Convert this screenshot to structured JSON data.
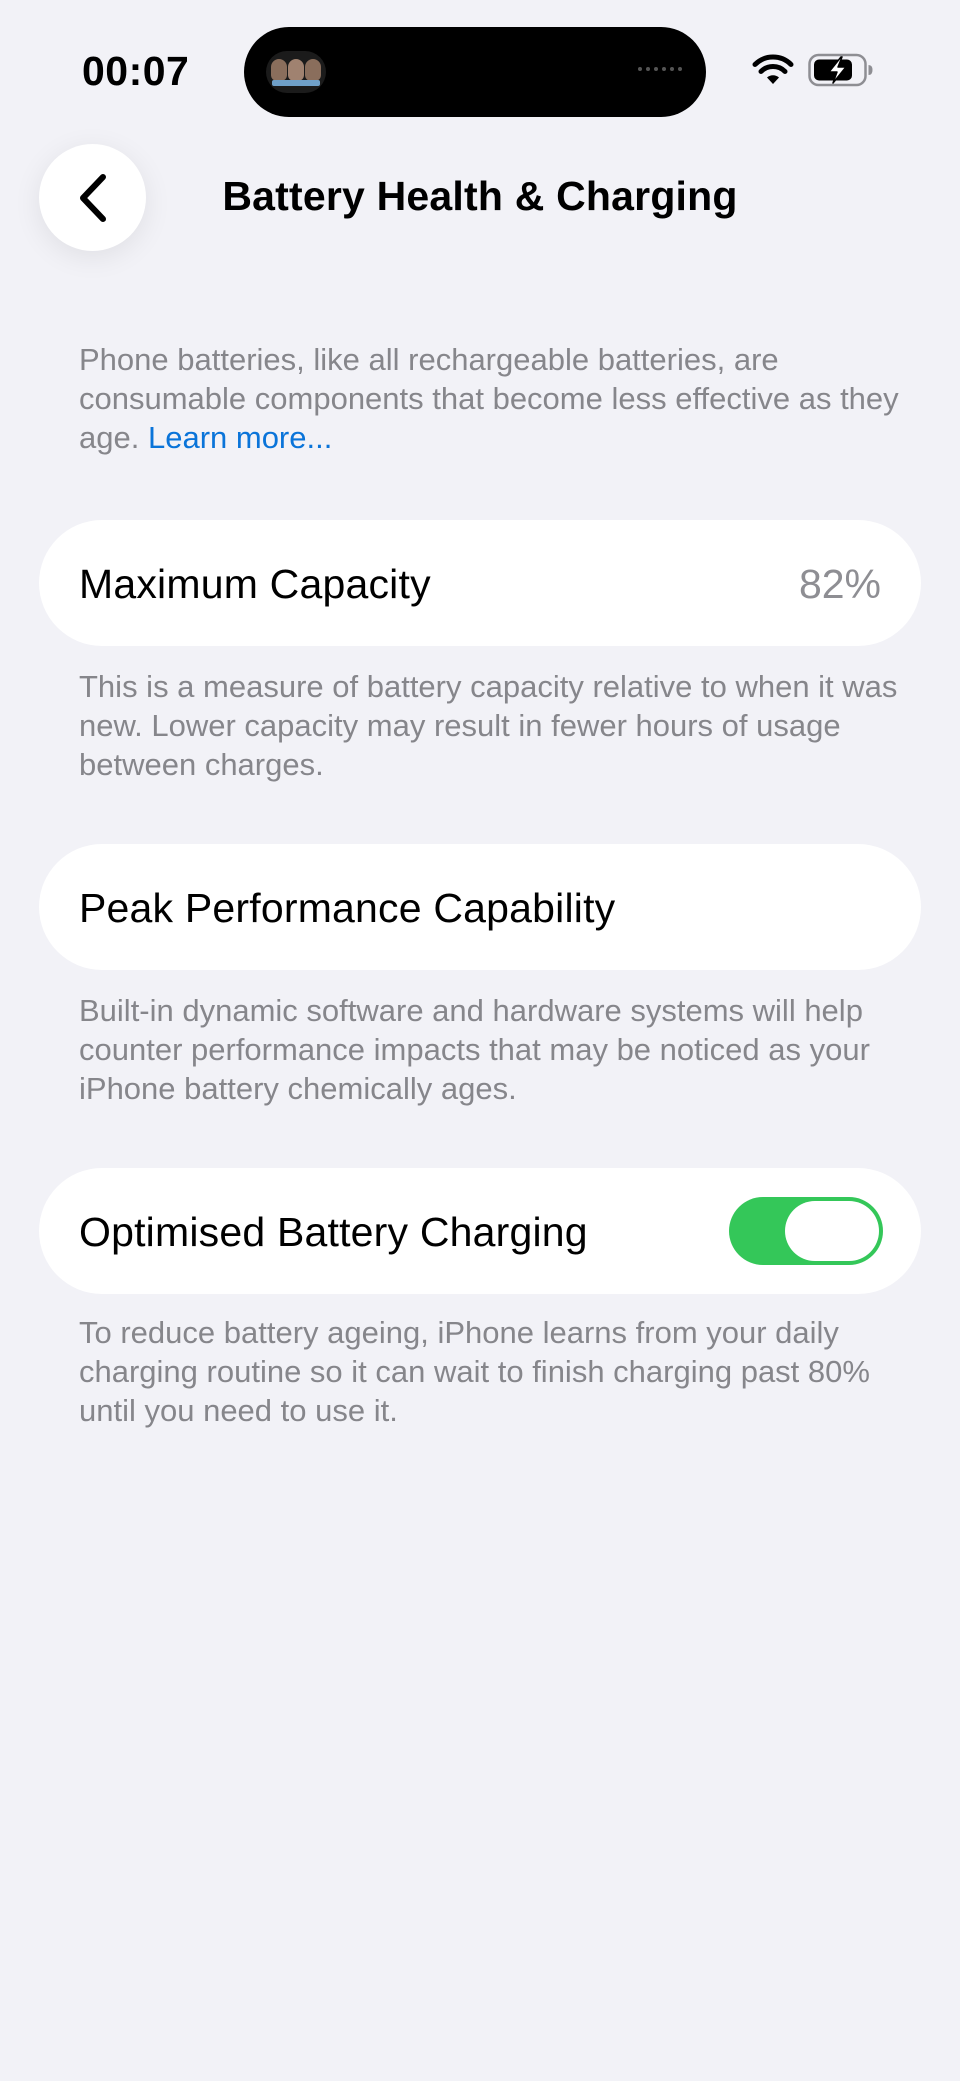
{
  "status_bar": {
    "time": "00:07",
    "icons": [
      "wifi-icon",
      "battery-charging-icon"
    ]
  },
  "nav": {
    "title": "Battery Health & Charging",
    "back_icon": "chevron-left-icon"
  },
  "intro": {
    "text": "Phone batteries, like all rechargeable batteries, are consumable components that become less effective as they age.",
    "link": "Learn more..."
  },
  "maximum_capacity": {
    "label": "Maximum Capacity",
    "value": "82%",
    "description": "This is a measure of battery capacity relative to when it was new. Lower capacity may result in fewer hours of usage between charges."
  },
  "peak_performance": {
    "label": "Peak Performance Capability",
    "description": "Built-in dynamic software and hardware systems will help counter performance impacts that may be noticed as your iPhone battery chemically ages."
  },
  "optimised_charging": {
    "label": "Optimised Battery Charging",
    "enabled": true,
    "description": "To reduce battery ageing, iPhone learns from your daily charging routine so it can wait to finish charging past 80% until you need to use it."
  },
  "colors": {
    "background": "#f2f2f7",
    "card": "#ffffff",
    "secondary_text": "#86868b",
    "link": "#0a74d9",
    "toggle_on": "#34c759"
  }
}
